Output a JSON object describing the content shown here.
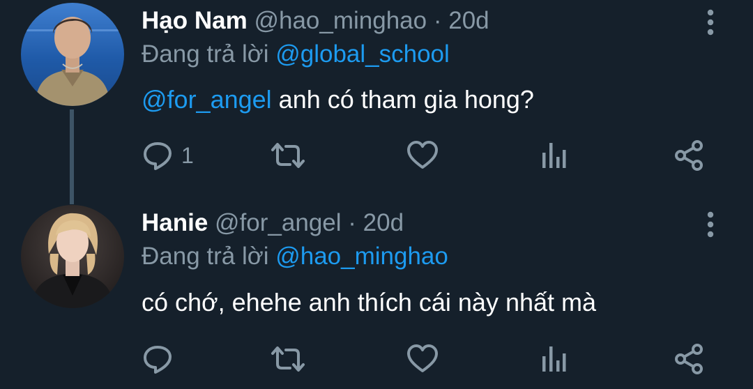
{
  "tweets": [
    {
      "display_name": "Hạo Nam",
      "handle": "@hao_minghao",
      "separator": "·",
      "time": "20d",
      "reply_prefix": "Đang trả lời",
      "reply_to": "@global_school",
      "body_mention": "@for_angel",
      "body_text": " anh có tham gia hong?",
      "reply_count": "1"
    },
    {
      "display_name": "Hanie",
      "handle": "@for_angel",
      "separator": "·",
      "time": "20d",
      "reply_prefix": "Đang trả lời",
      "reply_to": "@hao_minghao",
      "body_text": "có chớ, ehehe anh thích cái này nhất mà",
      "reply_count": ""
    }
  ],
  "colors": {
    "background": "#15202b",
    "text_primary": "#ffffff",
    "text_secondary": "#8899a6",
    "accent": "#1d9bf0",
    "thread_line": "#3d5466"
  },
  "icons": [
    "reply-icon",
    "retweet-icon",
    "like-icon",
    "views-icon",
    "share-icon",
    "more-icon"
  ]
}
